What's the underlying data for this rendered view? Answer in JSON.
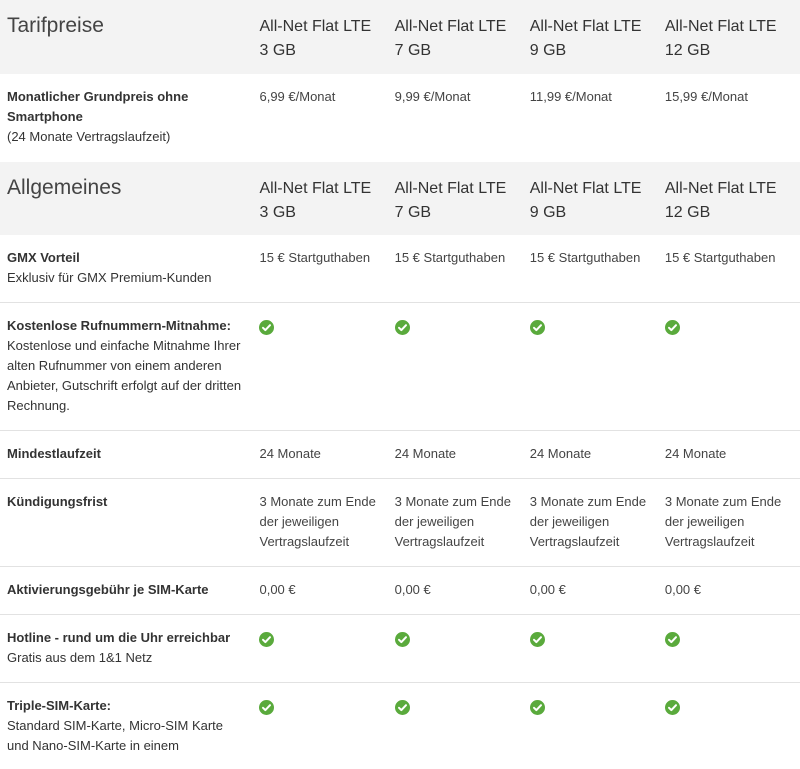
{
  "plans": [
    {
      "name": "All-Net Flat LTE",
      "size": "3 GB"
    },
    {
      "name": "All-Net Flat LTE",
      "size": "7 GB"
    },
    {
      "name": "All-Net Flat LTE",
      "size": "9 GB"
    },
    {
      "name": "All-Net Flat LTE",
      "size": "12 GB"
    }
  ],
  "sections": [
    {
      "title": "Tarifpreise",
      "rows": [
        {
          "label_title": "Monatlicher Grundpreis ohne Smartphone",
          "label_desc": "(24 Monate Vertragslaufzeit)",
          "cells": [
            "6,99 €/Monat",
            "9,99 €/Monat",
            "11,99 €/Monat",
            "15,99 €/Monat"
          ]
        }
      ]
    },
    {
      "title": "Allgemeines",
      "rows": [
        {
          "label_title": "GMX Vorteil",
          "label_desc": "Exklusiv für GMX Premium-Kunden",
          "cells": [
            "15 € Startguthaben",
            "15 € Startguthaben",
            "15 € Startguthaben",
            "15 € Startguthaben"
          ]
        },
        {
          "label_title": "Kostenlose Rufnummern-Mitnahme:",
          "label_desc": "Kostenlose und einfache Mitnahme Ihrer alten Rufnummer von einem anderen Anbieter, Gutschrift erfolgt auf der dritten Rechnung.",
          "cells": [
            "check",
            "check",
            "check",
            "check"
          ]
        },
        {
          "label_title": "Mindestlaufzeit",
          "label_desc": "",
          "cells": [
            "24 Monate",
            "24 Monate",
            "24 Monate",
            "24 Monate"
          ]
        },
        {
          "label_title": "Kündigungsfrist",
          "label_desc": "",
          "cells": [
            "3 Monate zum Ende der jeweiligen Vertragslaufzeit",
            "3 Monate zum Ende der jeweiligen Vertragslaufzeit",
            "3 Monate zum Ende der jeweiligen Vertragslaufzeit",
            "3 Monate zum Ende der jeweiligen Vertragslaufzeit"
          ]
        },
        {
          "label_title": "Aktivierungsgebühr je SIM-Karte",
          "label_desc": "",
          "cells": [
            "0,00 €",
            "0,00 €",
            "0,00 €",
            "0,00 €"
          ]
        },
        {
          "label_title": "Hotline - rund um die Uhr erreichbar",
          "label_desc": "Gratis aus dem 1&1 Netz",
          "cells": [
            "check",
            "check",
            "check",
            "check"
          ]
        },
        {
          "label_title": "Triple-SIM-Karte:",
          "label_desc": "Standard SIM-Karte, Micro-SIM Karte und Nano-SIM-Karte in einem",
          "cells": [
            "check",
            "check",
            "check",
            "check"
          ]
        }
      ]
    }
  ],
  "colors": {
    "check": "#5aaa3c",
    "header_bg": "#f3f3f3",
    "divider": "#e2e2e2"
  },
  "icons": {
    "check": "check-circle-icon"
  }
}
